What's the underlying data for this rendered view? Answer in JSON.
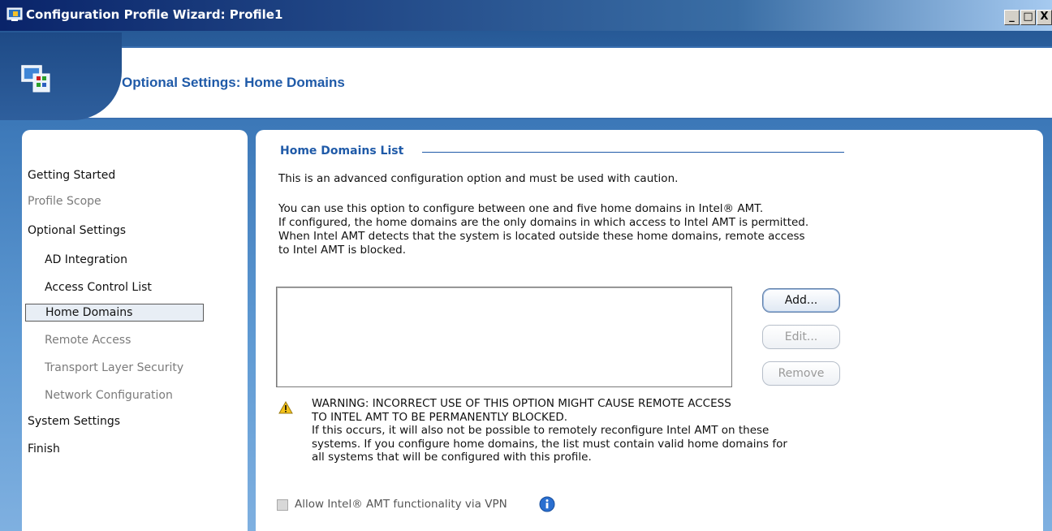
{
  "window": {
    "title": "Configuration Profile Wizard: Profile1",
    "controls": {
      "minimize": "_",
      "maximize": "□",
      "close": "X"
    }
  },
  "banner": {
    "title": "Optional Settings: Home Domains"
  },
  "nav": {
    "items": [
      {
        "label": "Getting Started",
        "state": "enabled"
      },
      {
        "label": "Profile Scope",
        "state": "disabled"
      },
      {
        "label": "Optional Settings",
        "state": "enabled"
      },
      {
        "label": "AD Integration",
        "state": "enabled"
      },
      {
        "label": "Access Control List",
        "state": "enabled"
      },
      {
        "label": "Home Domains",
        "state": "selected"
      },
      {
        "label": "Remote Access",
        "state": "disabled"
      },
      {
        "label": "Transport Layer Security",
        "state": "disabled"
      },
      {
        "label": "Network Configuration",
        "state": "disabled"
      },
      {
        "label": "System Settings",
        "state": "enabled"
      },
      {
        "label": "Finish",
        "state": "enabled"
      }
    ]
  },
  "main": {
    "section_title": "Home Domains List",
    "caution": "This is an advanced configuration option and must be used with caution.",
    "description_lines": [
      "You can use this option to configure between one and five home domains in Intel® AMT.",
      "If configured, the home domains are the only domains in which access to Intel AMT is permitted.",
      "When Intel AMT detects that the system is located outside these home domains, remote access",
      "to Intel AMT is blocked."
    ],
    "buttons": {
      "add": "Add...",
      "edit": "Edit...",
      "remove": "Remove"
    },
    "warning_lines": [
      "WARNING: INCORRECT USE OF THIS OPTION MIGHT CAUSE REMOTE ACCESS",
      "TO INTEL AMT TO BE PERMANENTLY BLOCKED.",
      "If this occurs, it will also not be possible to remotely reconfigure Intel AMT on these",
      "systems. If you configure home domains, the list must contain valid home domains for",
      "all systems that will be configured with this profile."
    ],
    "vpn_label": "Allow Intel® AMT functionality via VPN",
    "vpn_checked": false
  },
  "icons": {
    "window": "wizard-icon",
    "banner": "settings-computer-icon",
    "warning": "warning-icon",
    "info": "info-icon"
  },
  "colors": {
    "accent": "#1f5aa8",
    "title_bar": "#0a246a",
    "background_blue": "#3c78b8"
  }
}
